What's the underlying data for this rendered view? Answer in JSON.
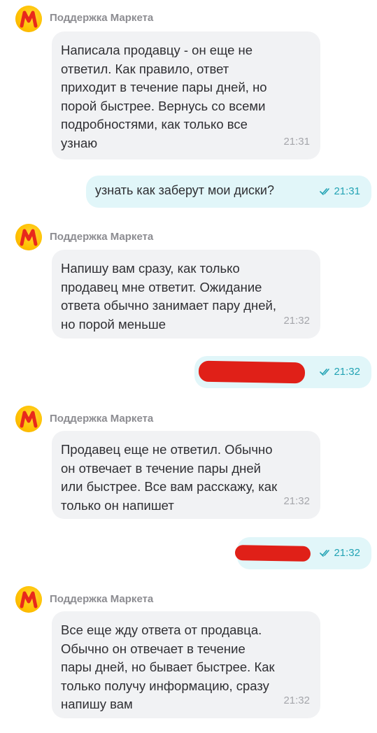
{
  "chat": {
    "sender_name": "Поддержка Маркета",
    "messages": [
      {
        "from": "support",
        "text": "Написала продавцу - он еще не ответил. Как правило, ответ приходит в течение пары дней, но порой быстрее. Вернусь со всеми подробностями, как только все узнаю",
        "time": "21:31"
      },
      {
        "from": "user",
        "text": "узнать как заберут мои диски?",
        "time": "21:31",
        "status": "read"
      },
      {
        "from": "support",
        "text": "Напишу вам сразу, как только продавец мне ответит. Ожидание ответа обычно занимает пару дней, но порой меньше",
        "time": "21:32"
      },
      {
        "from": "user",
        "text": "[redacted]",
        "time": "21:32",
        "status": "read"
      },
      {
        "from": "support",
        "text": "Продавец еще не ответил. Обычно он отвечает в течение пары дней или быстрее. Все вам расскажу, как только он напишет",
        "time": "21:32"
      },
      {
        "from": "user",
        "text": "[redacted]",
        "time": "21:32",
        "status": "read"
      },
      {
        "from": "support",
        "text": "Все еще жду ответа от продавца. Обычно он отвечает в течение пары дней, но бывает быстрее. Как только получу информацию, сразу напишу вам",
        "time": "21:32"
      }
    ]
  },
  "colors": {
    "incoming_bubble": "#f1f2f4",
    "outgoing_bubble": "#e1f6f9",
    "read_status": "#23a3b4",
    "redaction": "#e02018",
    "avatar_brand": "#ffcc00"
  },
  "icons": {
    "avatar": "yandex-market-logo-icon",
    "status": "double-check-icon"
  }
}
